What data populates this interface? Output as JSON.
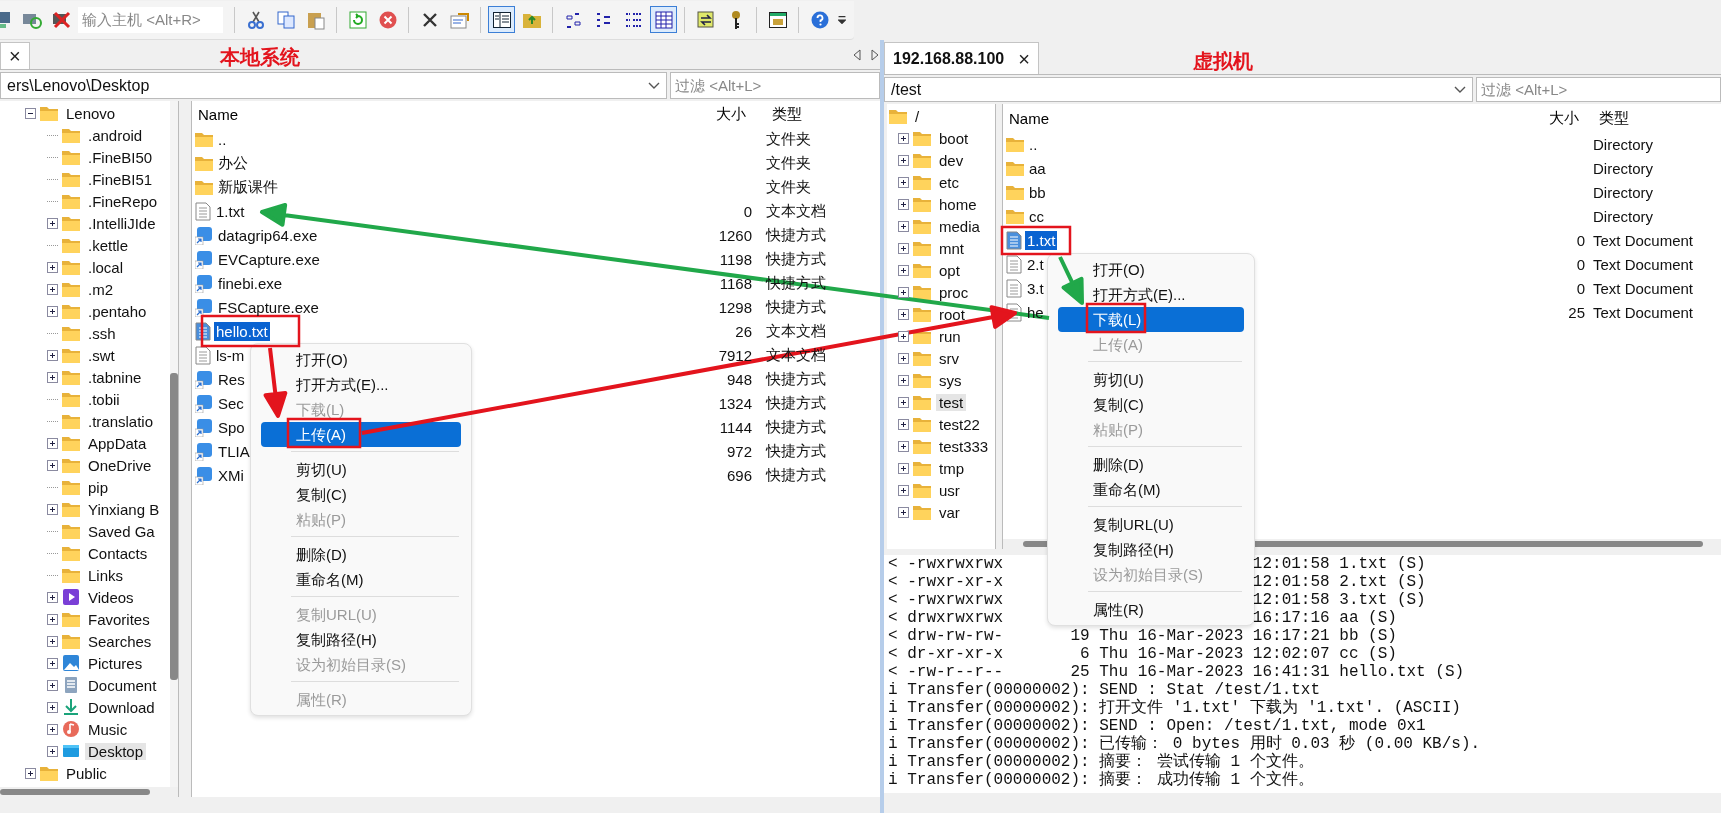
{
  "toolbar": [
    {
      "kind": "connect",
      "pressed": false
    },
    {
      "kind": "reconnect",
      "pressed": false
    },
    {
      "kind": "disconnect",
      "pressed": false
    },
    {
      "kind": "host-field",
      "placeholder": "输入主机 <Alt+R>"
    },
    {
      "kind": "separator"
    },
    {
      "kind": "cut",
      "pressed": false
    },
    {
      "kind": "copy",
      "pressed": false
    },
    {
      "kind": "paste",
      "pressed": false
    },
    {
      "kind": "separator"
    },
    {
      "kind": "refresh",
      "pressed": false
    },
    {
      "kind": "stop",
      "pressed": false
    },
    {
      "kind": "separator"
    },
    {
      "kind": "delete",
      "pressed": false
    },
    {
      "kind": "properties",
      "pressed": false
    },
    {
      "kind": "separator"
    },
    {
      "kind": "panel",
      "pressed": true
    },
    {
      "kind": "folder-up",
      "pressed": false
    },
    {
      "kind": "separator"
    },
    {
      "kind": "small-icons",
      "pressed": false
    },
    {
      "kind": "list",
      "pressed": false
    },
    {
      "kind": "tree-list",
      "pressed": false
    },
    {
      "kind": "details",
      "pressed": true
    },
    {
      "kind": "separator"
    },
    {
      "kind": "sync",
      "pressed": false
    },
    {
      "kind": "key",
      "pressed": false
    },
    {
      "kind": "separator"
    },
    {
      "kind": "queue",
      "pressed": false
    },
    {
      "kind": "separator"
    },
    {
      "kind": "help",
      "pressed": false
    },
    {
      "kind": "overflow",
      "pressed": false
    }
  ],
  "left_pane": {
    "annotation": "本地系统",
    "tab": {
      "close": "×",
      "selected": true
    },
    "path": "ers\\Lenovo\\Desktop",
    "filter_placeholder": "过滤 <Alt+L>",
    "tree": [
      {
        "label": "Lenovo",
        "kind": "folder",
        "expanded": true,
        "selected": false,
        "children": [
          {
            "label": ".android",
            "kind": "folder",
            "selected": false
          },
          {
            "label": ".FineBI50",
            "kind": "folder",
            "selected": false
          },
          {
            "label": ".FineBI51",
            "kind": "folder",
            "selected": false
          },
          {
            "label": ".FineRepo",
            "kind": "folder",
            "selected": false
          },
          {
            "label": ".IntelliJIde",
            "kind": "folder",
            "expanded": false,
            "selected": false
          },
          {
            "label": ".kettle",
            "kind": "folder",
            "selected": false
          },
          {
            "label": ".local",
            "kind": "folder",
            "expanded": false,
            "selected": false
          },
          {
            "label": ".m2",
            "kind": "folder",
            "expanded": false,
            "selected": false
          },
          {
            "label": ".pentaho",
            "kind": "folder",
            "expanded": false,
            "selected": false
          },
          {
            "label": ".ssh",
            "kind": "folder",
            "selected": false
          },
          {
            "label": ".swt",
            "kind": "folder",
            "expanded": false,
            "selected": false
          },
          {
            "label": ".tabnine",
            "kind": "folder",
            "expanded": false,
            "selected": false
          },
          {
            "label": ".tobii",
            "kind": "folder",
            "selected": false
          },
          {
            "label": ".translatio",
            "kind": "folder",
            "selected": false
          },
          {
            "label": "AppData",
            "kind": "folder",
            "expanded": false,
            "selected": false
          },
          {
            "label": "OneDrive",
            "kind": "folder",
            "expanded": false,
            "selected": false
          },
          {
            "label": "pip",
            "kind": "folder",
            "selected": false
          },
          {
            "label": "Yinxiang B",
            "kind": "folder",
            "expanded": false,
            "selected": false
          },
          {
            "label": "Saved Ga",
            "kind": "folder",
            "selected": false
          },
          {
            "label": "Contacts",
            "kind": "folder",
            "selected": false
          },
          {
            "label": "Links",
            "kind": "folder",
            "selected": false
          },
          {
            "label": "Videos",
            "kind": "videos",
            "expanded": false,
            "selected": false
          },
          {
            "label": "Favorites",
            "kind": "folder",
            "expanded": false,
            "selected": false
          },
          {
            "label": "Searches",
            "kind": "folder",
            "expanded": false,
            "selected": false
          },
          {
            "label": "Pictures",
            "kind": "pictures",
            "expanded": false,
            "selected": false
          },
          {
            "label": "Document",
            "kind": "documents",
            "expanded": false,
            "selected": false
          },
          {
            "label": "Download",
            "kind": "downloads",
            "expanded": false,
            "selected": false
          },
          {
            "label": "Music",
            "kind": "music",
            "expanded": false,
            "selected": false
          },
          {
            "label": "Desktop",
            "kind": "desktop",
            "expanded": false,
            "selected": true
          }
        ]
      },
      {
        "label": "Public",
        "kind": "folder",
        "expanded": false,
        "selected": false
      }
    ],
    "columns": [
      "Name",
      "大小",
      "类型"
    ],
    "rows": [
      {
        "kind": "folder",
        "name": "..",
        "type": "文件夹",
        "selected": false
      },
      {
        "kind": "folder",
        "name": "办公",
        "type": "文件夹",
        "selected": false
      },
      {
        "kind": "folder",
        "name": "新版课件",
        "type": "文件夹",
        "selected": false
      },
      {
        "kind": "text",
        "name": "1.txt",
        "size": "0",
        "type": "文本文档",
        "selected": false
      },
      {
        "kind": "shortcut",
        "name": "datagrip64.exe",
        "size": "1260",
        "type": "快捷方式",
        "selected": false
      },
      {
        "kind": "shortcut",
        "name": "EVCapture.exe",
        "size": "1198",
        "type": "快捷方式",
        "selected": false
      },
      {
        "kind": "shortcut",
        "name": "finebi.exe",
        "size": "1168",
        "type": "快捷方式",
        "selected": false
      },
      {
        "kind": "shortcut",
        "name": "FSCapture.exe",
        "size": "1298",
        "type": "快捷方式",
        "selected": false
      },
      {
        "kind": "text",
        "name": "hello.txt",
        "size": "26",
        "type": "文本文档",
        "selected": true
      },
      {
        "kind": "text",
        "name": "ls-m",
        "size": "7912",
        "type": "文本文档",
        "selected": false
      },
      {
        "kind": "shortcut",
        "name": "Res",
        "size": "948",
        "type": "快捷方式",
        "selected": false
      },
      {
        "kind": "shortcut",
        "name": "Sec",
        "size": "1324",
        "type": "快捷方式",
        "selected": false
      },
      {
        "kind": "shortcut",
        "name": "Spo",
        "size": "1144",
        "type": "快捷方式",
        "selected": false
      },
      {
        "kind": "shortcut",
        "name": "TLIA",
        "size": "972",
        "type": "快捷方式",
        "selected": false
      },
      {
        "kind": "shortcut",
        "name": "XMi",
        "size": "696",
        "type": "快捷方式",
        "selected": false
      }
    ],
    "context_menu": [
      {
        "kind": "item",
        "label": "打开(O)",
        "disabled": false,
        "selected": false
      },
      {
        "kind": "item",
        "label": "打开方式(E)...",
        "disabled": false,
        "selected": false
      },
      {
        "kind": "item",
        "label": "下载(L)",
        "disabled": true,
        "selected": false
      },
      {
        "kind": "item",
        "label": "上传(A)",
        "disabled": false,
        "selected": true
      },
      {
        "kind": "separator"
      },
      {
        "kind": "item",
        "label": "剪切(U)",
        "disabled": false,
        "selected": false
      },
      {
        "kind": "item",
        "label": "复制(C)",
        "disabled": false,
        "selected": false
      },
      {
        "kind": "item",
        "label": "粘贴(P)",
        "disabled": true,
        "selected": false
      },
      {
        "kind": "separator"
      },
      {
        "kind": "item",
        "label": "删除(D)",
        "disabled": false,
        "selected": false
      },
      {
        "kind": "item",
        "label": "重命名(M)",
        "disabled": false,
        "selected": false
      },
      {
        "kind": "separator"
      },
      {
        "kind": "item",
        "label": "复制URL(U)",
        "disabled": true,
        "selected": false
      },
      {
        "kind": "item",
        "label": "复制路径(H)",
        "disabled": false,
        "selected": false
      },
      {
        "kind": "item",
        "label": "设为初始目录(S)",
        "disabled": true,
        "selected": false
      },
      {
        "kind": "separator"
      },
      {
        "kind": "item",
        "label": "属性(R)",
        "disabled": true,
        "selected": false
      }
    ]
  },
  "right_pane": {
    "annotation": "虚拟机",
    "tab": {
      "label": "192.168.88.100",
      "close": "×",
      "selected": true
    },
    "path": "/test",
    "filter_placeholder": "过滤 <Alt+L>",
    "tree": [
      {
        "label": "/",
        "kind": "folder",
        "selected": false,
        "children": [
          {
            "label": "boot",
            "kind": "folder",
            "expanded": false,
            "selected": false
          },
          {
            "label": "dev",
            "kind": "folder",
            "expanded": false,
            "selected": false
          },
          {
            "label": "etc",
            "kind": "folder",
            "expanded": false,
            "selected": false
          },
          {
            "label": "home",
            "kind": "folder",
            "expanded": false,
            "selected": false
          },
          {
            "label": "media",
            "kind": "folder",
            "expanded": false,
            "selected": false
          },
          {
            "label": "mnt",
            "kind": "folder",
            "expanded": false,
            "selected": false
          },
          {
            "label": "opt",
            "kind": "folder",
            "expanded": false,
            "selected": false
          },
          {
            "label": "proc",
            "kind": "folder",
            "expanded": false,
            "selected": false
          },
          {
            "label": "root",
            "kind": "folder",
            "expanded": false,
            "selected": false
          },
          {
            "label": "run",
            "kind": "folder",
            "expanded": false,
            "selected": false
          },
          {
            "label": "srv",
            "kind": "folder",
            "expanded": false,
            "selected": false
          },
          {
            "label": "sys",
            "kind": "folder",
            "expanded": false,
            "selected": false
          },
          {
            "label": "test",
            "kind": "folder",
            "expanded": false,
            "selected": true
          },
          {
            "label": "test22",
            "kind": "folder",
            "expanded": false,
            "selected": false
          },
          {
            "label": "test333",
            "kind": "folder",
            "expanded": false,
            "selected": false
          },
          {
            "label": "tmp",
            "kind": "folder",
            "expanded": false,
            "selected": false
          },
          {
            "label": "usr",
            "kind": "folder",
            "expanded": false,
            "selected": false
          },
          {
            "label": "var",
            "kind": "folder",
            "expanded": false,
            "selected": false
          }
        ]
      }
    ],
    "columns": [
      "Name",
      "大小",
      "类型"
    ],
    "rows": [
      {
        "kind": "folder",
        "name": "..",
        "type": "Directory",
        "selected": false
      },
      {
        "kind": "folder",
        "name": "aa",
        "type": "Directory",
        "selected": false
      },
      {
        "kind": "folder",
        "name": "bb",
        "type": "Directory",
        "selected": false
      },
      {
        "kind": "folder",
        "name": "cc",
        "type": "Directory",
        "selected": false
      },
      {
        "kind": "text",
        "name": "1.txt",
        "size": "0",
        "type": "Text Document",
        "selected": true
      },
      {
        "kind": "text",
        "name": "2.t",
        "size": "0",
        "type": "Text Document",
        "selected": false
      },
      {
        "kind": "text",
        "name": "3.t",
        "size": "0",
        "type": "Text Document",
        "selected": false
      },
      {
        "kind": "text",
        "name": "he",
        "size": "25",
        "type": "Text Document",
        "selected": false
      }
    ],
    "context_menu": [
      {
        "kind": "item",
        "label": "打开(O)",
        "disabled": false,
        "selected": false
      },
      {
        "kind": "item",
        "label": "打开方式(E)...",
        "disabled": false,
        "selected": false
      },
      {
        "kind": "item",
        "label": "下载(L)",
        "disabled": false,
        "selected": true
      },
      {
        "kind": "item",
        "label": "上传(A)",
        "disabled": true,
        "selected": false
      },
      {
        "kind": "separator"
      },
      {
        "kind": "item",
        "label": "剪切(U)",
        "disabled": false,
        "selected": false
      },
      {
        "kind": "item",
        "label": "复制(C)",
        "disabled": false,
        "selected": false
      },
      {
        "kind": "item",
        "label": "粘贴(P)",
        "disabled": true,
        "selected": false
      },
      {
        "kind": "separator"
      },
      {
        "kind": "item",
        "label": "删除(D)",
        "disabled": false,
        "selected": false
      },
      {
        "kind": "item",
        "label": "重命名(M)",
        "disabled": false,
        "selected": false
      },
      {
        "kind": "separator"
      },
      {
        "kind": "item",
        "label": "复制URL(U)",
        "disabled": false,
        "selected": false
      },
      {
        "kind": "item",
        "label": "复制路径(H)",
        "disabled": false,
        "selected": false
      },
      {
        "kind": "item",
        "label": "设为初始目录(S)",
        "disabled": true,
        "selected": false
      },
      {
        "kind": "separator"
      },
      {
        "kind": "item",
        "label": "属性(R)",
        "disabled": false,
        "selected": false
      }
    ],
    "log": [
      {
        "head": "< -rwxrwxrwx",
        "tail": "12:01:58 1.txt (S)"
      },
      {
        "head": "< -rwxr-xr-x",
        "tail": "12:01:58 2.txt (S)"
      },
      {
        "head": "< -rwxrwxrwx",
        "tail": "12:01:58 3.txt (S)"
      },
      {
        "head": "< drwxrwxrwx",
        "tail": "16:17:16 aa (S)"
      },
      {
        "text": "< drw-rw-rw-       19 Thu 16-Mar-2023 16:17:21 bb (S)"
      },
      {
        "text": "< dr-xr-xr-x        6 Thu 16-Mar-2023 12:02:07 cc (S)"
      },
      {
        "text": "< -rw-r--r--       25 Thu 16-Mar-2023 16:41:31 hello.txt (S)"
      },
      {
        "text": "i Transfer(00000002): SEND : Stat /test/1.txt"
      },
      {
        "text": "i Transfer(00000002): 打开文件 '1.txt' 下载为 '1.txt'. (ASCII)"
      },
      {
        "text": "i Transfer(00000002): SEND : Open: /test/1.txt, mode 0x1"
      },
      {
        "text": "i Transfer(00000002): 已传输： 0 bytes 用时 0.03 秒 (0.00 KB/s)."
      },
      {
        "text": "i Transfer(00000002): 摘要： 尝试传输 1 个文件。"
      },
      {
        "text": "i Transfer(00000002): 摘要： 成功传输 1 个文件。"
      }
    ]
  }
}
